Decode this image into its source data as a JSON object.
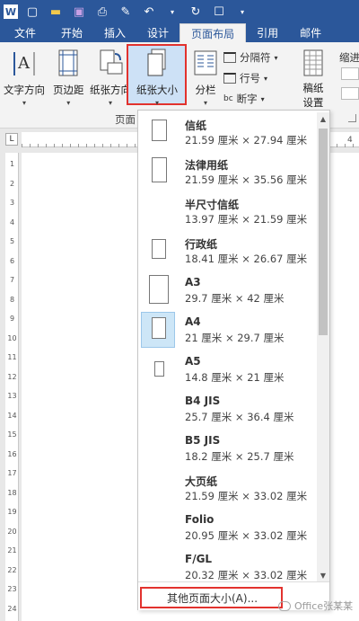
{
  "tabs": [
    {
      "label": "文件"
    },
    {
      "label": "开始"
    },
    {
      "label": "插入"
    },
    {
      "label": "设计"
    },
    {
      "label": "页面布局"
    },
    {
      "label": "引用"
    },
    {
      "label": "邮件"
    }
  ],
  "ribbon": {
    "text_direction": "文字方向",
    "margins": "页边距",
    "orientation": "纸张方向",
    "size": "纸张大小",
    "columns": "分栏",
    "breaks": "分隔符",
    "line_numbers": "行号",
    "hyphenation": "断字",
    "draft_paper_1": "稿纸",
    "draft_paper_2": "设置",
    "indent": "缩进",
    "group_page_setup": "页面"
  },
  "paper_sizes": [
    {
      "name": "信纸",
      "size": "21.59 厘米 × 27.94 厘米",
      "has_thumb": true
    },
    {
      "name": "法律用纸",
      "size": "21.59 厘米 × 35.56 厘米",
      "has_thumb": true
    },
    {
      "name": "半尺寸信纸",
      "size": "13.97 厘米 × 21.59 厘米",
      "has_thumb": false
    },
    {
      "name": "行政纸",
      "size": "18.41 厘米 × 26.67 厘米",
      "has_thumb": true
    },
    {
      "name": "A3",
      "size": "29.7 厘米 × 42 厘米",
      "has_thumb": true
    },
    {
      "name": "A4",
      "size": "21 厘米 × 29.7 厘米",
      "has_thumb": true,
      "selected": true
    },
    {
      "name": "A5",
      "size": "14.8 厘米 × 21 厘米",
      "has_thumb": true
    },
    {
      "name": "B4 JIS",
      "size": "25.7 厘米 × 36.4 厘米",
      "has_thumb": false
    },
    {
      "name": "B5 JIS",
      "size": "18.2 厘米 × 25.7 厘米",
      "has_thumb": false
    },
    {
      "name": "大页纸",
      "size": "21.59 厘米 × 33.02 厘米",
      "has_thumb": false
    },
    {
      "name": "Folio",
      "size": "20.95 厘米 × 33.02 厘米",
      "has_thumb": false
    },
    {
      "name": "F/GL",
      "size": "20.32 厘米 × 33.02 厘米",
      "has_thumb": false
    }
  ],
  "more_sizes": "其他页面大小(A)...",
  "ruler": {
    "corner": "L",
    "h_number": "4",
    "v_numbers": [
      "1",
      "2",
      "3",
      "4",
      "5",
      "6",
      "7",
      "8",
      "9",
      "10",
      "11",
      "12",
      "13",
      "14",
      "15",
      "16",
      "17",
      "18",
      "19",
      "20",
      "21",
      "22",
      "23",
      "24"
    ]
  },
  "watermark": "Office张某某",
  "colors": {
    "accent": "#2b579a",
    "highlight": "#e2322e",
    "selected": "#cde6f7"
  }
}
